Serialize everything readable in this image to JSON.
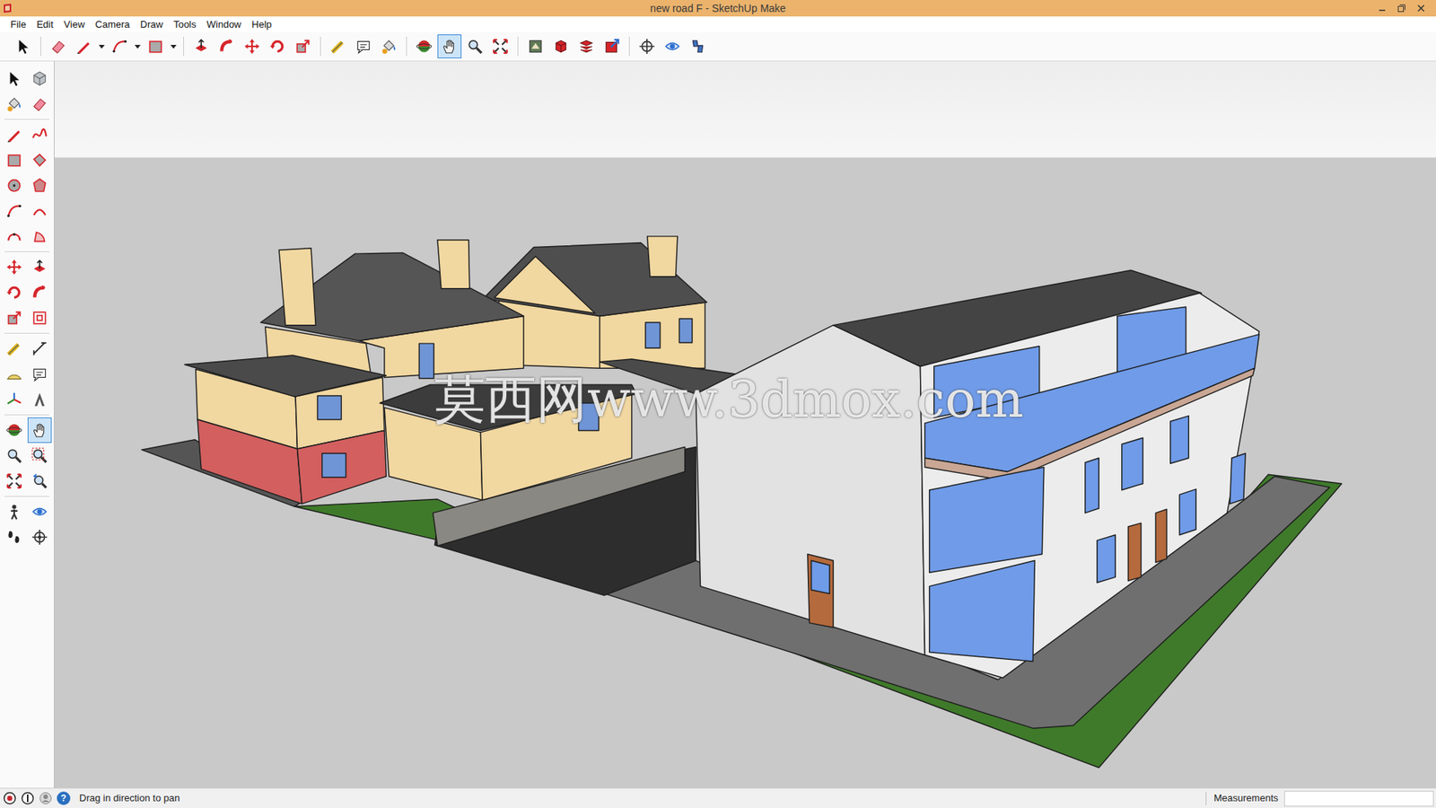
{
  "window": {
    "title": "new road F - SketchUp Make"
  },
  "menu": [
    "File",
    "Edit",
    "View",
    "Camera",
    "Draw",
    "Tools",
    "Window",
    "Help"
  ],
  "toolbar": [
    {
      "tools": [
        {
          "kind": "select",
          "selected": false
        }
      ]
    },
    {
      "tools": [
        {
          "kind": "eraser",
          "selected": false
        },
        {
          "kind": "pencil",
          "selected": false
        },
        {
          "kind": "dropdown",
          "selected": false
        },
        {
          "kind": "arc",
          "selected": false
        },
        {
          "kind": "dropdown",
          "selected": false
        },
        {
          "kind": "rectangle",
          "selected": false
        },
        {
          "kind": "dropdown",
          "selected": false
        }
      ]
    },
    {
      "tools": [
        {
          "kind": "pushpull",
          "selected": false
        },
        {
          "kind": "followme",
          "selected": false
        },
        {
          "kind": "move",
          "selected": false
        },
        {
          "kind": "rotate",
          "selected": false
        },
        {
          "kind": "scale",
          "selected": false
        }
      ]
    },
    {
      "tools": [
        {
          "kind": "tape",
          "selected": false
        },
        {
          "kind": "text",
          "selected": false
        },
        {
          "kind": "paint",
          "selected": false
        }
      ]
    },
    {
      "tools": [
        {
          "kind": "orbit",
          "selected": false
        },
        {
          "kind": "pan",
          "selected": true
        },
        {
          "kind": "zoom",
          "selected": false
        },
        {
          "kind": "zoom-extents",
          "selected": false
        }
      ]
    },
    {
      "tools": [
        {
          "kind": "warehouse",
          "selected": false
        },
        {
          "kind": "components",
          "selected": false
        },
        {
          "kind": "extensions",
          "selected": false
        },
        {
          "kind": "share",
          "selected": false
        }
      ]
    },
    {
      "tools": [
        {
          "kind": "position-camera",
          "selected": false
        },
        {
          "kind": "look-around",
          "selected": false
        },
        {
          "kind": "walk",
          "selected": false
        }
      ]
    }
  ],
  "palette": [
    {
      "tools": [
        {
          "kind": "select",
          "selected": false
        },
        {
          "kind": "component",
          "selected": false
        },
        {
          "kind": "paint",
          "selected": false
        },
        {
          "kind": "eraser",
          "selected": false
        }
      ]
    },
    {
      "tools": [
        {
          "kind": "pencil",
          "selected": false
        },
        {
          "kind": "freehand",
          "selected": false
        },
        {
          "kind": "rectangle",
          "selected": false
        },
        {
          "kind": "rotated-rectangle",
          "selected": false
        },
        {
          "kind": "circle",
          "selected": false
        },
        {
          "kind": "polygon",
          "selected": false
        },
        {
          "kind": "arc",
          "selected": false
        },
        {
          "kind": "arc-2pt",
          "selected": false
        },
        {
          "kind": "arc-3pt",
          "selected": false
        },
        {
          "kind": "pie",
          "selected": false
        }
      ]
    },
    {
      "tools": [
        {
          "kind": "move",
          "selected": false
        },
        {
          "kind": "pushpull",
          "selected": false
        },
        {
          "kind": "rotate",
          "selected": false
        },
        {
          "kind": "followme",
          "selected": false
        },
        {
          "kind": "scale",
          "selected": false
        },
        {
          "kind": "offset",
          "selected": false
        }
      ]
    },
    {
      "tools": [
        {
          "kind": "tape",
          "selected": false
        },
        {
          "kind": "dimension",
          "selected": false
        },
        {
          "kind": "protractor",
          "selected": false
        },
        {
          "kind": "text",
          "selected": false
        },
        {
          "kind": "axes",
          "selected": false
        },
        {
          "kind": "text-3d",
          "selected": false
        }
      ]
    },
    {
      "tools": [
        {
          "kind": "orbit",
          "selected": false
        },
        {
          "kind": "pan",
          "selected": true
        },
        {
          "kind": "zoom",
          "selected": false
        },
        {
          "kind": "zoom-window",
          "selected": false
        },
        {
          "kind": "zoom-extents",
          "selected": false
        },
        {
          "kind": "zoom-previous",
          "selected": false
        }
      ]
    },
    {
      "tools": [
        {
          "kind": "position-camera",
          "selected": false
        },
        {
          "kind": "look-around",
          "selected": false
        },
        {
          "kind": "walk",
          "selected": false
        },
        {
          "kind": "section",
          "selected": false
        }
      ]
    }
  ],
  "watermark": "莫西网www.3dmox.com",
  "status_bar": {
    "help": "?",
    "message": "Drag in direction to pan",
    "measurements_label": "Measurements"
  }
}
